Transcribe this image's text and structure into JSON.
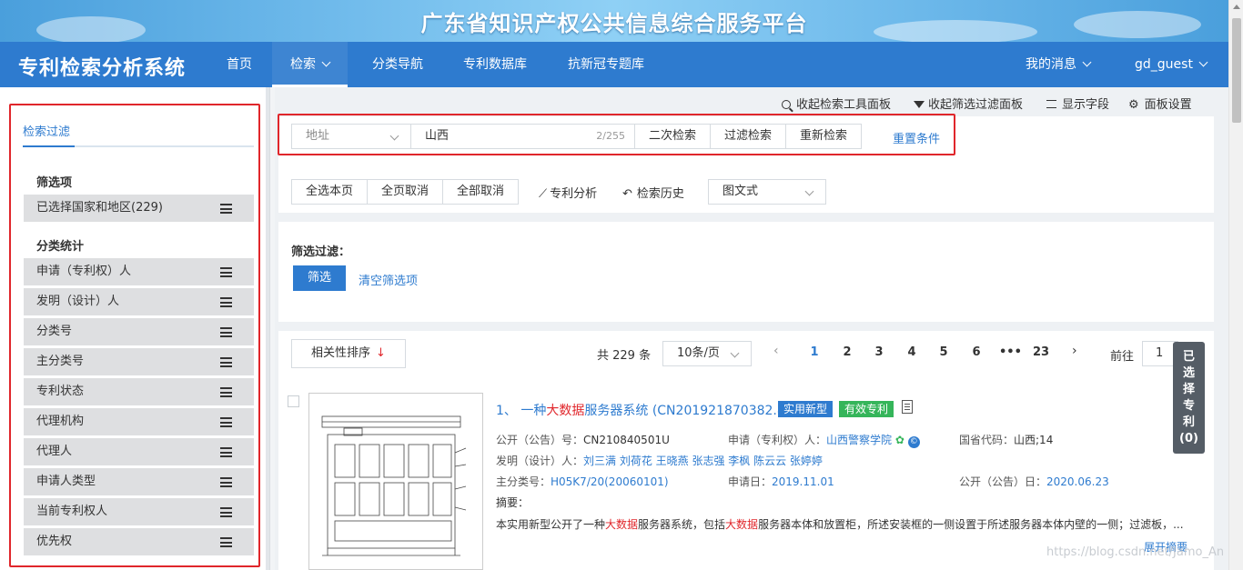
{
  "banner": {
    "title": "广东省知识产权公共信息综合服务平台"
  },
  "navbar": {
    "brand": "专利检索分析系统",
    "items": [
      "首页",
      "检索",
      "分类导航",
      "专利数据库",
      "抗新冠专题库"
    ],
    "messages": "我的消息",
    "user": "gd_guest"
  },
  "sidebar": {
    "tab": "检索过滤",
    "filter_heading": "筛选项",
    "selected_region": "已选择国家和地区(229)",
    "stats_heading": "分类统计",
    "stats_items": [
      "申请（专利权）人",
      "发明（设计）人",
      "分类号",
      "主分类号",
      "专利状态",
      "代理机构",
      "代理人",
      "申请人类型",
      "当前专利权人",
      "优先权"
    ]
  },
  "toolbar": {
    "collapse_search": "收起检索工具面板",
    "collapse_filter": "收起筛选过滤面板",
    "show_fields": "显示字段",
    "panel_settings": "面板设置"
  },
  "search": {
    "field": "地址",
    "value": "山西",
    "counter": "2/255",
    "btn_secondary": "二次检索",
    "btn_filter": "过滤检索",
    "btn_new": "重新检索",
    "reset": "重置条件"
  },
  "actions": {
    "select_page": "全选本页",
    "unselect_page": "全页取消",
    "unselect_all": "全部取消",
    "analysis": "专利分析",
    "history": "检索历史",
    "view_mode": "图文式"
  },
  "filter_panel": {
    "label": "筛选过滤：",
    "btn": "筛选",
    "clear": "清空筛选项"
  },
  "results": {
    "sort": "相关性排序",
    "total": "共 229 条",
    "per_page": "10条/页",
    "pages": [
      "1",
      "2",
      "3",
      "4",
      "5",
      "6",
      "•••",
      "23"
    ],
    "goto_label": "前往",
    "goto_value": "1",
    "selected_tab": [
      "已",
      "选",
      "择",
      "专",
      "利",
      "(0)"
    ]
  },
  "patent": {
    "index": "1、",
    "title_pre": "一种",
    "title_hl": "大数据",
    "title_post": "服务器系统 (CN201921870382.8)",
    "tag_type": "实用新型",
    "tag_status": "有效专利",
    "pub_label": "公开（公告）号：",
    "pub_value": "CN210840501U",
    "applicant_label": "申请（专利权）人：",
    "applicant_value": "山西警察学院",
    "region_label": "国省代码：",
    "region_value": "山西;14",
    "inventor_label": "发明（设计）人：",
    "inventors": "刘三满  刘荷花  王晓燕  张志强  李枫  陈云云  张婷婷",
    "main_class_label": "主分类号：",
    "main_class_value": "H05K7/20(20060101)",
    "app_date_label": "申请日：",
    "app_date_value": "2019.11.01",
    "pub_date_label": "公开（公告）日：",
    "pub_date_value": "2020.06.23",
    "abstract_label": "摘要：",
    "abs_1": "本实用新型公开了一种",
    "abs_hl1": "大数据",
    "abs_2": "服务器系统，包括",
    "abs_hl2": "大数据",
    "abs_3": "服务器本体和放置柜，所述安装框的一侧设置于所述服务器本体内壁的一侧；过滤板，...",
    "expand": "展开摘要"
  },
  "watermark": "https://blog.csdn.net/Jamo_An",
  "colors": {
    "primary": "#2e7bcf",
    "highlight_box": "#e0262b",
    "tag_type": "#2e7bcf",
    "tag_status": "#35b55a"
  }
}
